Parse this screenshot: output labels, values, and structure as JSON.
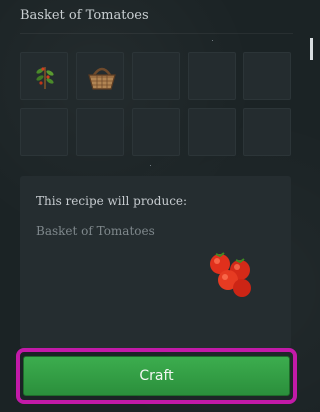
{
  "window": {
    "title": "Basket of Tomatoes"
  },
  "grid": {
    "slots": [
      {
        "item_icon": "herb-sprig-icon"
      },
      {
        "item_icon": "wicker-basket-icon"
      },
      {
        "item_icon": ""
      },
      {
        "item_icon": ""
      },
      {
        "item_icon": ""
      },
      {
        "item_icon": ""
      },
      {
        "item_icon": ""
      },
      {
        "item_icon": ""
      },
      {
        "item_icon": ""
      },
      {
        "item_icon": ""
      }
    ]
  },
  "recipe": {
    "produce_label": "This recipe will produce:",
    "result_name": "Basket of Tomatoes",
    "result_icon": "tomatoes-icon"
  },
  "actions": {
    "craft_label": "Craft"
  },
  "colors": {
    "craft_button": "#3cad4e",
    "highlight_outline": "#c21aa8",
    "background": "#1b2325"
  }
}
